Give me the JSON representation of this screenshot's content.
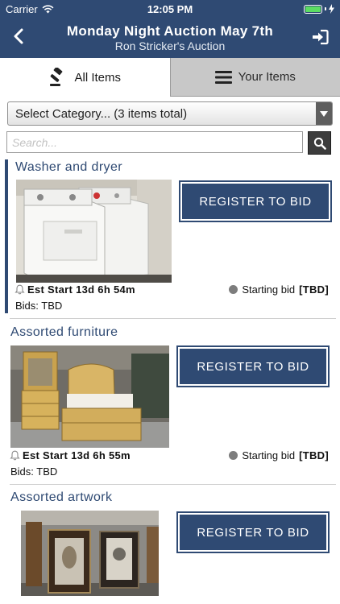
{
  "status_bar": {
    "carrier": "Carrier",
    "time": "12:05 PM"
  },
  "header": {
    "title": "Monday Night Auction May 7th",
    "subtitle": "Ron Stricker's Auction",
    "background": "#2f4a73"
  },
  "tabs": [
    {
      "label": "All Items",
      "icon": "gavel-icon",
      "active": true
    },
    {
      "label": "Your Items",
      "icon": "list-icon",
      "active": false
    }
  ],
  "category": {
    "label": "Select Category... (3 items total)"
  },
  "search": {
    "placeholder": "Search..."
  },
  "items": [
    {
      "title": "Washer and dryer",
      "button": "REGISTER TO BID",
      "est_start": "Est Start 13d 6h 54m",
      "starting_bid_label": "Starting bid",
      "starting_bid_value": "[TBD]",
      "bids": "Bids: TBD"
    },
    {
      "title": "Assorted furniture",
      "button": "REGISTER TO BID",
      "est_start": "Est Start 13d 6h 55m",
      "starting_bid_label": "Starting bid",
      "starting_bid_value": "[TBD]",
      "bids": "Bids: TBD"
    },
    {
      "title": "Assorted artwork",
      "button": "REGISTER TO BID"
    }
  ]
}
